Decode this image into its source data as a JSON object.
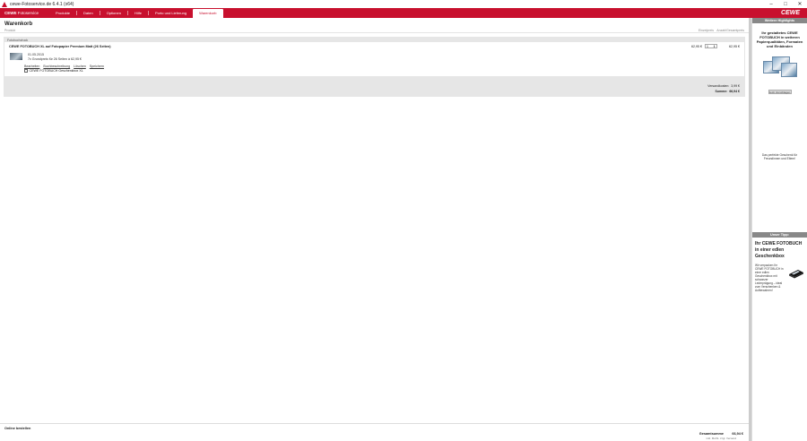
{
  "window": {
    "title": "cewe-Fotoservice.de 6.4.1 (x64)",
    "controls": [
      "–",
      "□",
      "✕"
    ]
  },
  "menu": {
    "brand_bold": "CEWE",
    "brand_rest": " Fotoservice",
    "tabs": [
      "Produkte",
      "Daten",
      "Optionen",
      "Hilfe",
      "Porto und Lieferung",
      "Warenkorb"
    ],
    "active_tab": "Warenkorb",
    "logo": "CEWE"
  },
  "cart": {
    "title": "Warenkorb",
    "col_product": "Produkt",
    "col_unit_price": "Einzelpreis",
    "col_qty": "Anzahl",
    "col_total": "Gesamtpreis",
    "group_label": "Fotobuchdruck",
    "item": {
      "name": "CEWE FOTOBUCH XL auf Fotopapier Premium Matt (26 Seiten)",
      "date": "01.05.2015",
      "pages": "7x Grundpreis für 26 Seiten à 62,95 €",
      "unit_price": "62,95 €",
      "qty": "1",
      "total_price": "62,95 €",
      "links": [
        "Bearbeiten",
        "Buchbeschreibung",
        "Löschen",
        "Speichern"
      ],
      "gift_option": "CEWE FOTOBUCH Geschenkbox XL"
    },
    "shipping_label": "Versandkosten:",
    "shipping_value": "3,99 €",
    "sum_label": "Summe:",
    "sum_value": "66,94 €"
  },
  "status": {
    "online": "Online bestellen",
    "grand_total_label": "Gesamtsumme",
    "grand_total_value": "66,94 €",
    "note": "inkl. MwSt. zzgl. Versand"
  },
  "sidebar": {
    "head1": "Weitere Highlights",
    "promo_title": "Ihr gestaltetes CEWE FOTOBUCH in weiteren Papierqualitäten, Formaten und Einbänden",
    "promo_button": "Jetzt Vorschlagen",
    "promo_note": "Das perfekte Geschenk für Freundinnen und Eltern!",
    "head2": "Unser Tipp:",
    "tip_title": "Ihr CEWE FOTOBUCH in einer edlen Geschenkbox",
    "tip_text": "Wir verpacken Ihr CEWE FOTOBUCH in einer edlen Geschenkbox mit schwarzer Lederprägung – ideal zum Verschenken & Aufbewahren!"
  }
}
